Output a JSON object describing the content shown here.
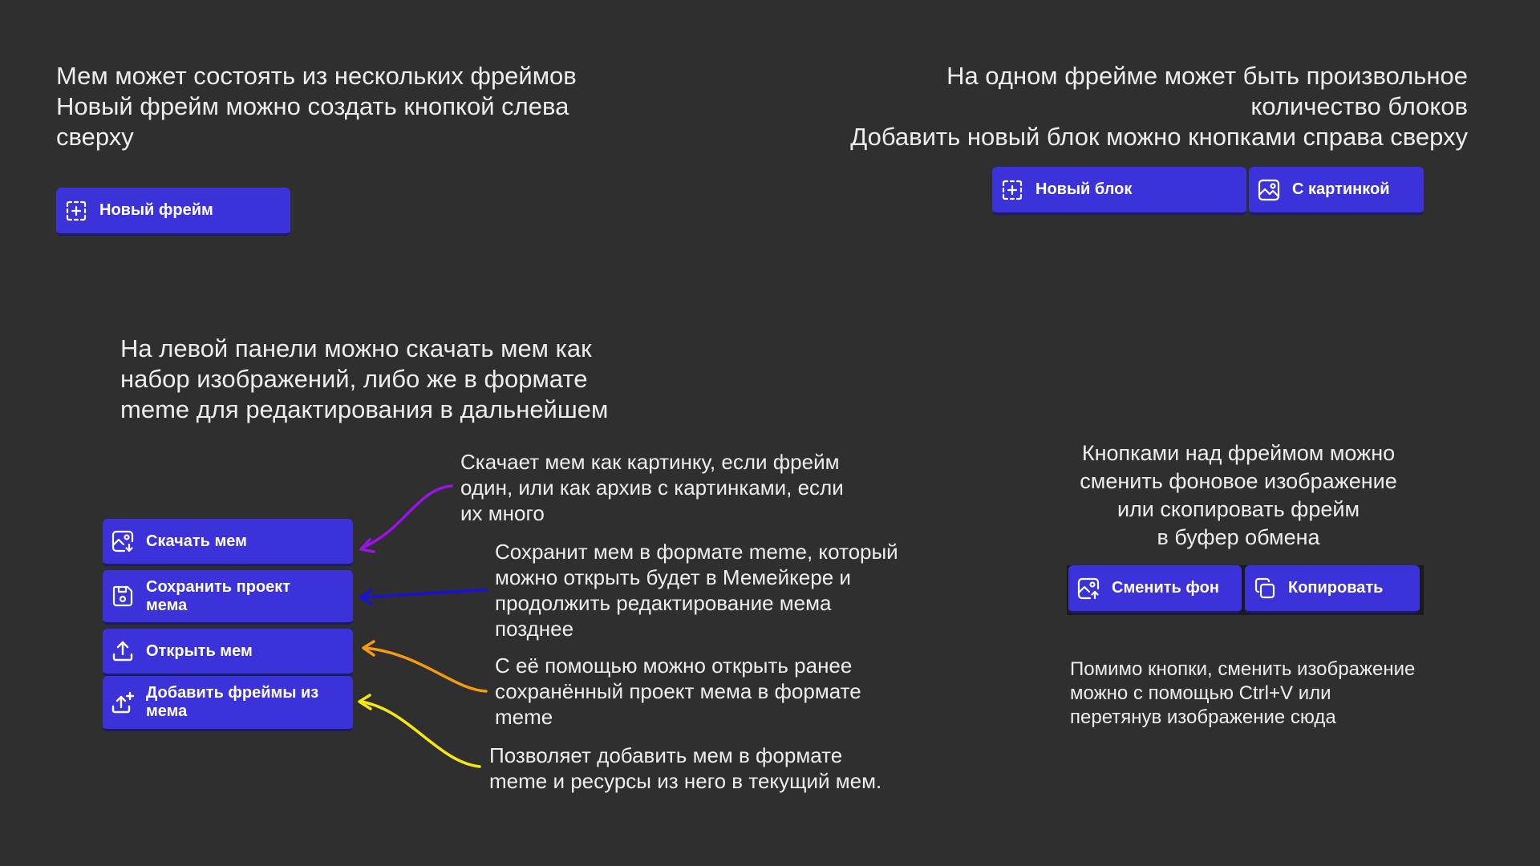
{
  "intro_frames": {
    "lines": [
      "Мем может состоять из нескольких фреймов",
      "Новый фрейм можно создать кнопкой слева",
      "сверху"
    ]
  },
  "intro_blocks": {
    "lines": [
      "На одном фрейме может быть произвольное",
      "количество блоков",
      "Добавить новый блок можно кнопками справа сверху"
    ]
  },
  "intro_panel": {
    "lines": [
      "На левой панели можно скачать мем как",
      "набор изображений, либо же в формате",
      "meme для редактирования в дальнейшем"
    ]
  },
  "intro_bg": {
    "lines": [
      "Кнопками над фреймом можно",
      "сменить фоновое изображение",
      "или скопировать фрейм",
      "в буфер обмена"
    ]
  },
  "hint_paste": {
    "lines": [
      "Помимо кнопки, сменить изображение",
      "можно с помощью Ctrl+V или",
      "перетянув изображение сюда"
    ]
  },
  "buttons": {
    "new_frame": {
      "label": "Новый фрейм",
      "icon": "add-frame-icon"
    },
    "new_block": {
      "label": "Новый блок",
      "icon": "add-frame-icon"
    },
    "with_image": {
      "label": "С картинкой",
      "icon": "image-icon"
    },
    "download": {
      "label": "Скачать мем",
      "icon": "image-download-icon"
    },
    "save": {
      "label_lines": [
        "Сохранить проект",
        "мема"
      ],
      "icon": "save-icon"
    },
    "open": {
      "label": "Открыть мем",
      "icon": "upload-icon"
    },
    "add_frames": {
      "label_lines": [
        "Добавить фреймы из",
        "мема"
      ],
      "icon": "upload-plus-icon"
    },
    "change_bg": {
      "label": "Сменить фон",
      "icon": "image-upload-icon"
    },
    "copy": {
      "label": "Копировать",
      "icon": "copy-icon"
    }
  },
  "descriptions": {
    "download": [
      "Скачает мем как картинку, если фрейм",
      "один, или как архив с картинками, если",
      "их много"
    ],
    "save": [
      "Сохранит мем в формате meme, который",
      "можно открыть будет в Мемейкере и",
      "продолжить редактирование мема",
      "позднее"
    ],
    "open": [
      "С её помощью можно открыть ранее",
      "сохранённый проект мема в формате",
      "meme"
    ],
    "add": [
      "Позволяет добавить мем в формате",
      "meme и ресурсы из него в текущий мем."
    ]
  },
  "colors": {
    "background": "#2f2f2f",
    "button": "#3b33d9",
    "arrow_download": "#9b12e6",
    "arrow_save": "#1a12d9",
    "arrow_open": "#f59a12",
    "arrow_add": "#f5e812"
  }
}
